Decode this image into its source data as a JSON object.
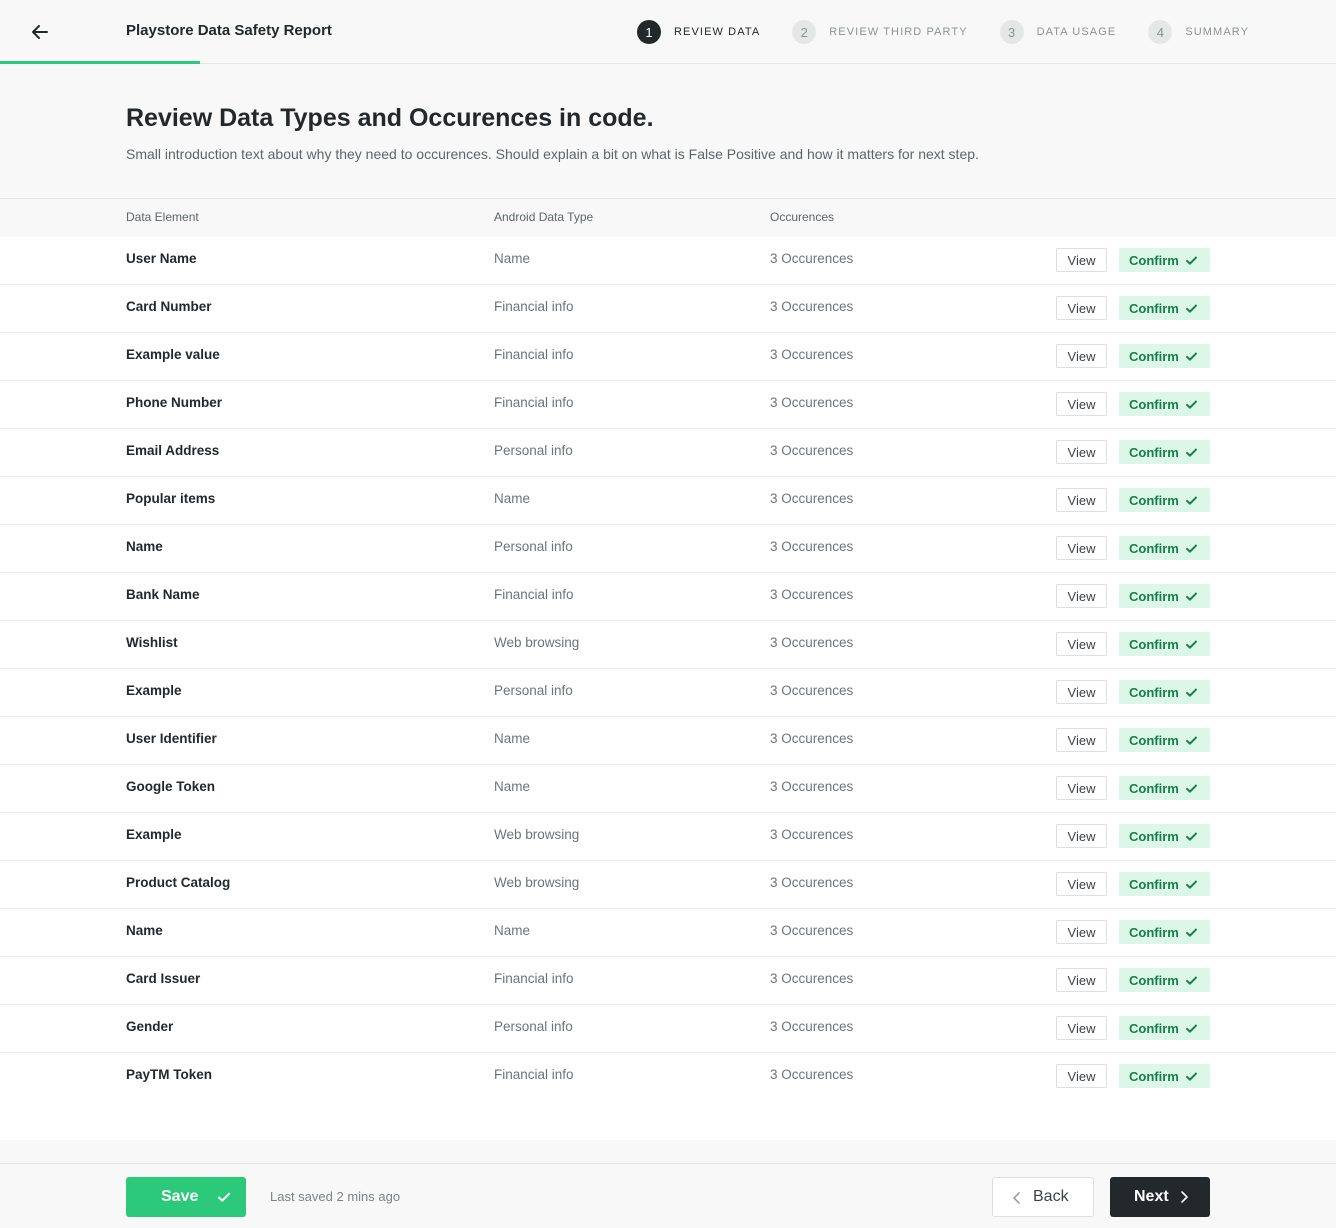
{
  "header": {
    "back_icon": "arrow-left-icon",
    "title": "Playstore Data Safety Report",
    "steps": [
      {
        "number": "1",
        "label": "REVIEW DATA",
        "active": true
      },
      {
        "number": "2",
        "label": "REVIEW THIRD PARTY",
        "active": false
      },
      {
        "number": "3",
        "label": "DATA USAGE",
        "active": false
      },
      {
        "number": "4",
        "label": "SUMMARY",
        "active": false
      }
    ],
    "progress_color": "#2cc97a"
  },
  "intro": {
    "title": "Review Data Types and Occurences in code.",
    "text": "Small introduction text about why they need to occurences. Should explain a bit on what is False Positive and how it matters for next step."
  },
  "table": {
    "columns": [
      "Data Element",
      "Android Data Type",
      "Occurences"
    ],
    "view_label": "View",
    "confirm_label": "Confirm",
    "rows": [
      {
        "element": "User Name",
        "type": "Name",
        "occurrences": "3 Occurences"
      },
      {
        "element": "Card Number",
        "type": "Financial info",
        "occurrences": "3 Occurences"
      },
      {
        "element": "Example value",
        "type": "Financial info",
        "occurrences": "3 Occurences"
      },
      {
        "element": "Phone Number",
        "type": "Financial info",
        "occurrences": "3 Occurences"
      },
      {
        "element": "Email Address",
        "type": "Personal info",
        "occurrences": "3 Occurences"
      },
      {
        "element": "Popular items",
        "type": "Name",
        "occurrences": "3 Occurences"
      },
      {
        "element": "Name",
        "type": "Personal info",
        "occurrences": "3 Occurences"
      },
      {
        "element": "Bank Name",
        "type": "Financial info",
        "occurrences": "3 Occurences"
      },
      {
        "element": "Wishlist",
        "type": "Web browsing",
        "occurrences": "3 Occurences"
      },
      {
        "element": "Example",
        "type": "Personal info",
        "occurrences": "3 Occurences"
      },
      {
        "element": "User Identifier",
        "type": "Name",
        "occurrences": "3 Occurences"
      },
      {
        "element": "Google Token",
        "type": "Name",
        "occurrences": "3 Occurences"
      },
      {
        "element": "Example",
        "type": "Web browsing",
        "occurrences": "3 Occurences"
      },
      {
        "element": "Product Catalog",
        "type": "Web browsing",
        "occurrences": "3 Occurences"
      },
      {
        "element": "Name",
        "type": "Name",
        "occurrences": "3 Occurences"
      },
      {
        "element": "Card Issuer",
        "type": "Financial info",
        "occurrences": "3 Occurences"
      },
      {
        "element": "Gender",
        "type": "Personal info",
        "occurrences": "3 Occurences"
      },
      {
        "element": "PayTM Token",
        "type": "Financial info",
        "occurrences": "3 Occurences"
      }
    ]
  },
  "footer": {
    "save_label": "Save",
    "last_saved": "Last saved 2 mins ago",
    "back_label": "Back",
    "next_label": "Next",
    "save_color": "#2cc97a",
    "next_color": "#23282b"
  }
}
